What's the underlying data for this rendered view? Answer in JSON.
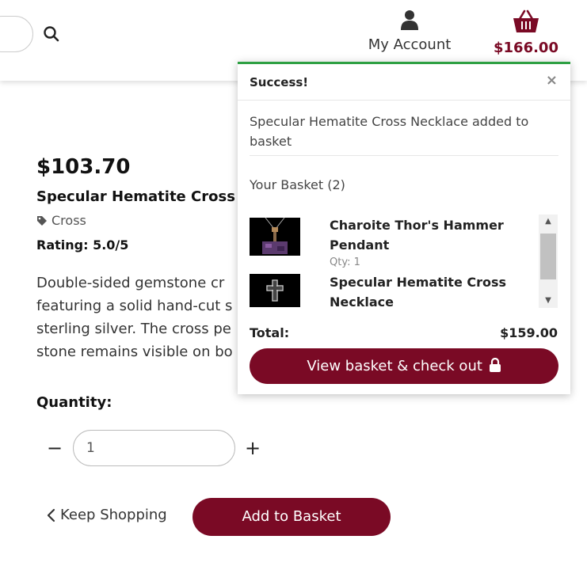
{
  "header": {
    "account_label": "My Account",
    "basket_total": "$166.00"
  },
  "product": {
    "price": "$103.70",
    "name": "Specular Hematite Cross N",
    "tag": "Cross",
    "rating": "Rating: 5.0/5",
    "description_lines": [
      "Double-sided gemstone cr",
      "featuring a solid hand-cut s",
      "sterling silver. The cross pe",
      "stone remains visible on bo"
    ],
    "quantity_label": "Quantity:",
    "quantity_value": "1",
    "keep_shopping_label": "Keep Shopping",
    "add_to_basket_label": "Add to Basket"
  },
  "popup": {
    "title": "Success!",
    "close_symbol": "×",
    "message": "Specular Hematite Cross Necklace added to basket",
    "basket_title": "Your Basket (2)",
    "items": [
      {
        "name": "Charoite Thor's Hammer Pendant",
        "qty": "Qty: 1"
      },
      {
        "name": "Specular Hematite Cross Necklace",
        "qty": ""
      }
    ],
    "total_label": "Total:",
    "total_value": "$159.00",
    "checkout_label": "View basket & check out"
  },
  "colors": {
    "brand": "#7a0a25",
    "success": "#2ea043"
  },
  "icons": [
    "search-icon",
    "user-icon",
    "basket-icon",
    "tag-icon",
    "close-icon",
    "chevron-left-icon",
    "lock-icon"
  ]
}
